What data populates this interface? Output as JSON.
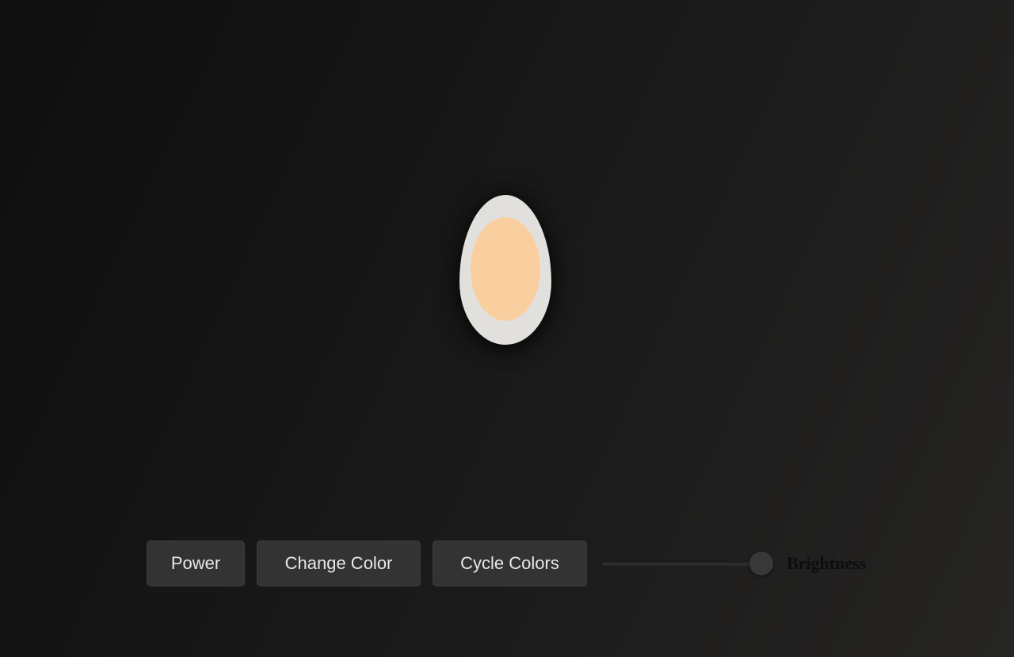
{
  "lamp": {
    "power_on": true,
    "shell_color": "#e2e0dc",
    "light_color": "#facf9f"
  },
  "controls": {
    "power_label": "Power",
    "change_color_label": "Change Color",
    "cycle_colors_label": "Cycle Colors",
    "brightness_label": "Brightness",
    "brightness_value": 100
  },
  "colors": {
    "button_bg": "#333333",
    "button_text": "#e8e8e8",
    "background_dark": "#0f0f0f"
  }
}
